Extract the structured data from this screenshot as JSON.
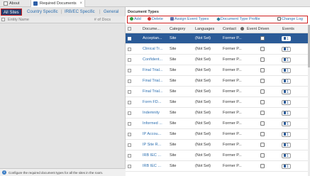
{
  "tabs": [
    {
      "label": "About"
    },
    {
      "label": "Required Documents"
    }
  ],
  "tab_close": "×",
  "filters": [
    {
      "label": "All Sites"
    },
    {
      "label": "Country Specific"
    },
    {
      "label": "IRB/EC Specific"
    },
    {
      "label": "General"
    }
  ],
  "filter_sep": "|",
  "left_list": {
    "col_name": "Entity Name",
    "col_docs": "# of Docs"
  },
  "footer_text": "Configure the required document types for all the sites in the room.",
  "panel_title": "Document Types",
  "toolbar": {
    "add": "Add",
    "delete": "Delete",
    "assign": "Assign Event Types",
    "profile": "Document Type Profile",
    "change_log": "Change Log"
  },
  "columns": {
    "document": "Docume...",
    "category": "Category",
    "languages": "Languages",
    "contact": "Contact",
    "event_driven": "Event Driven",
    "events": "Events"
  },
  "rows": [
    {
      "doc": "Acceptan...",
      "category": "Site",
      "languages": "(Not Set)",
      "contact": "Former P...",
      "events": "1",
      "selected": true
    },
    {
      "doc": "Clinical Tr...",
      "category": "Site",
      "languages": "(Not Set)",
      "contact": "Former P...",
      "events": "1"
    },
    {
      "doc": "Confident...",
      "category": "Site",
      "languages": "(Not Set)",
      "contact": "Former P...",
      "events": "1"
    },
    {
      "doc": "Final Trial...",
      "category": "Site",
      "languages": "(Not Set)",
      "contact": "Former P...",
      "events": "1"
    },
    {
      "doc": "Final Trial...",
      "category": "Site",
      "languages": "(Not Set)",
      "contact": "Former P...",
      "events": "1"
    },
    {
      "doc": "Final Trial...",
      "category": "Site",
      "languages": "(Not Set)",
      "contact": "Former P...",
      "events": "1"
    },
    {
      "doc": "Form FD...",
      "category": "Site",
      "languages": "(Not Set)",
      "contact": "Former P...",
      "events": "1"
    },
    {
      "doc": "Indemnity",
      "category": "Site",
      "languages": "(Not Set)",
      "contact": "Former P...",
      "events": "1"
    },
    {
      "doc": "Informed ...",
      "category": "Site",
      "languages": "(Not Set)",
      "contact": "Former P...",
      "events": "1"
    },
    {
      "doc": "IP Accou...",
      "category": "Site",
      "languages": "(Not Set)",
      "contact": "Former P...",
      "events": "1"
    },
    {
      "doc": "IP Site R...",
      "category": "Site",
      "languages": "(Not Set)",
      "contact": "Former P...",
      "events": "1"
    },
    {
      "doc": "IRB IEC ...",
      "category": "Site",
      "languages": "(Not Set)",
      "contact": "Former P...",
      "events": "1"
    },
    {
      "doc": "IRB IEC ...",
      "category": "Site",
      "languages": "(Not Set)",
      "contact": "Former P...",
      "events": "1"
    }
  ]
}
